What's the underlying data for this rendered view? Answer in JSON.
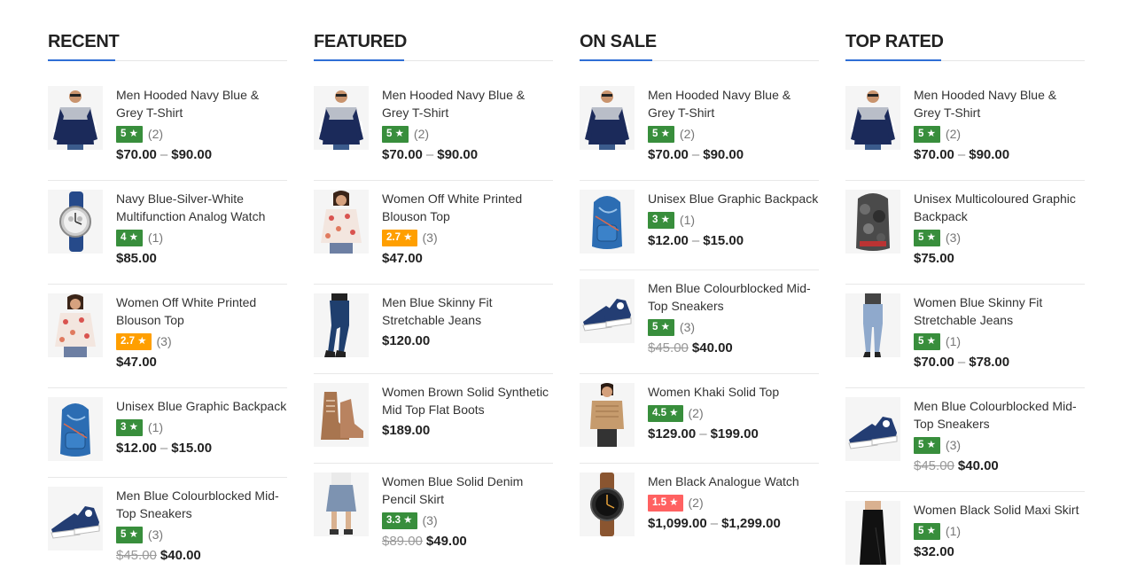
{
  "colors": {
    "accent": "#2f6fd6",
    "rating_green": "#388e3c",
    "rating_orange": "#ff9f00",
    "rating_red": "#ff6161"
  },
  "columns": [
    {
      "title": "RECENT",
      "products": [
        {
          "name": "Men Hooded Navy Blue & Grey T-Shirt",
          "rating": "5 ★",
          "rating_color": "#388e3c",
          "count": "(2)",
          "price_from": "$70.00",
          "price_to": "$90.00",
          "image": "hooded-tshirt"
        },
        {
          "name": "Navy Blue-Silver-White Multifunction Analog Watch",
          "rating": "4 ★",
          "rating_color": "#388e3c",
          "count": "(1)",
          "price": "$85.00",
          "image": "silver-watch"
        },
        {
          "name": "Women Off White Printed Blouson Top",
          "rating": "2.7 ★",
          "rating_color": "#ff9f00",
          "count": "(3)",
          "price": "$47.00",
          "image": "blouson-top"
        },
        {
          "name": "Unisex Blue Graphic Backpack",
          "rating": "3 ★",
          "rating_color": "#388e3c",
          "count": "(1)",
          "price_from": "$12.00",
          "price_to": "$15.00",
          "image": "blue-backpack"
        },
        {
          "name": "Men Blue Colourblocked Mid-Top Sneakers",
          "rating": "5 ★",
          "rating_color": "#388e3c",
          "count": "(3)",
          "price_old": "$45.00",
          "price": "$40.00",
          "image": "sneakers"
        }
      ]
    },
    {
      "title": "FEATURED",
      "products": [
        {
          "name": "Men Hooded Navy Blue & Grey T-Shirt",
          "rating": "5 ★",
          "rating_color": "#388e3c",
          "count": "(2)",
          "price_from": "$70.00",
          "price_to": "$90.00",
          "image": "hooded-tshirt"
        },
        {
          "name": "Women Off White Printed Blouson Top",
          "rating": "2.7 ★",
          "rating_color": "#ff9f00",
          "count": "(3)",
          "price": "$47.00",
          "image": "blouson-top"
        },
        {
          "name": "Men Blue Skinny Fit Stretchable Jeans",
          "price": "$120.00",
          "image": "men-jeans"
        },
        {
          "name": "Women Brown Solid Synthetic Mid Top Flat Boots",
          "price": "$189.00",
          "image": "boots"
        },
        {
          "name": "Women Blue Solid Denim Pencil Skirt",
          "rating": "3.3 ★",
          "rating_color": "#388e3c",
          "count": "(3)",
          "price_old": "$89.00",
          "price": "$49.00",
          "image": "denim-skirt"
        }
      ]
    },
    {
      "title": "ON SALE",
      "products": [
        {
          "name": "Men Hooded Navy Blue & Grey T-Shirt",
          "rating": "5 ★",
          "rating_color": "#388e3c",
          "count": "(2)",
          "price_from": "$70.00",
          "price_to": "$90.00",
          "image": "hooded-tshirt"
        },
        {
          "name": "Unisex Blue Graphic Backpack",
          "rating": "3 ★",
          "rating_color": "#388e3c",
          "count": "(1)",
          "price_from": "$12.00",
          "price_to": "$15.00",
          "image": "blue-backpack"
        },
        {
          "name": "Men Blue Colourblocked Mid-Top Sneakers",
          "rating": "5 ★",
          "rating_color": "#388e3c",
          "count": "(3)",
          "price_old": "$45.00",
          "price": "$40.00",
          "image": "sneakers"
        },
        {
          "name": "Women Khaki Solid Top",
          "rating": "4.5 ★",
          "rating_color": "#388e3c",
          "count": "(2)",
          "price_from": "$129.00",
          "price_to": "$199.00",
          "image": "khaki-top"
        },
        {
          "name": "Men Black Analogue Watch",
          "rating": "1.5 ★",
          "rating_color": "#ff6161",
          "count": "(2)",
          "price_from": "$1,099.00",
          "price_to": "$1,299.00",
          "image": "black-watch"
        }
      ]
    },
    {
      "title": "TOP RATED",
      "products": [
        {
          "name": "Men Hooded Navy Blue & Grey T-Shirt",
          "rating": "5 ★",
          "rating_color": "#388e3c",
          "count": "(2)",
          "price_from": "$70.00",
          "price_to": "$90.00",
          "image": "hooded-tshirt"
        },
        {
          "name": "Unisex Multicoloured Graphic Backpack",
          "rating": "5 ★",
          "rating_color": "#388e3c",
          "count": "(3)",
          "price": "$75.00",
          "image": "camo-backpack"
        },
        {
          "name": "Women Blue Skinny Fit Stretchable Jeans",
          "rating": "5 ★",
          "rating_color": "#388e3c",
          "count": "(1)",
          "price_from": "$70.00",
          "price_to": "$78.00",
          "image": "women-jeans"
        },
        {
          "name": "Men Blue Colourblocked Mid-Top Sneakers",
          "rating": "5 ★",
          "rating_color": "#388e3c",
          "count": "(3)",
          "price_old": "$45.00",
          "price": "$40.00",
          "image": "sneakers"
        },
        {
          "name": "Women Black Solid Maxi Skirt",
          "rating": "5 ★",
          "rating_color": "#388e3c",
          "count": "(1)",
          "price": "$32.00",
          "image": "maxi-skirt"
        }
      ]
    }
  ]
}
